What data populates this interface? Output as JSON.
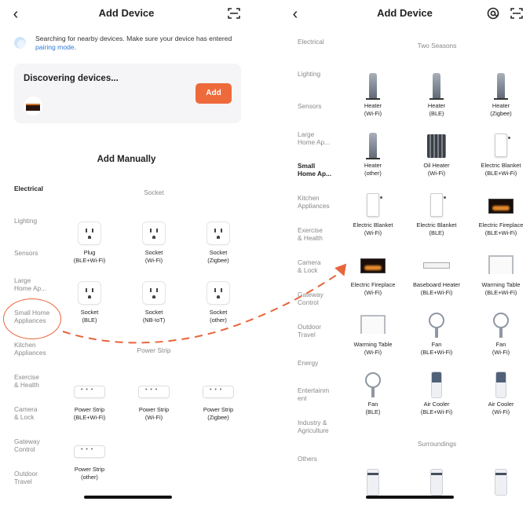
{
  "left": {
    "title": "Add Device",
    "search_text": "Searching for nearby devices. Make sure your device has entered",
    "pairing_link": "pairing mode",
    "search_end": ".",
    "discover_title": "Discovering devices...",
    "add_label": "Add",
    "add_manually": "Add Manually",
    "categories": [
      "Electrical",
      "Lighting",
      "Sensors",
      "Large\nHome Ap...",
      "Small Home\nAppliances",
      "Kitchen\nAppliances",
      "Exercise\n& Health",
      "Camera\n& Lock",
      "Gateway\nControl",
      "Outdoor\nTravel"
    ],
    "active_category": "Electrical",
    "groups": {
      "socket": "Socket",
      "power_strip": "Power Strip"
    },
    "sockets": [
      {
        "name": "Plug",
        "sub": "(BLE+Wi-Fi)"
      },
      {
        "name": "Socket",
        "sub": "(Wi-Fi)"
      },
      {
        "name": "Socket",
        "sub": "(Zigbee)"
      },
      {
        "name": "Socket",
        "sub": "(BLE)"
      },
      {
        "name": "Socket",
        "sub": "(NB-IoT)"
      },
      {
        "name": "Socket",
        "sub": "(other)"
      }
    ],
    "strips": [
      {
        "name": "Power Strip",
        "sub": "(BLE+Wi-Fi)"
      },
      {
        "name": "Power Strip",
        "sub": "(Wi-Fi)"
      },
      {
        "name": "Power Strip",
        "sub": "(Zigbee)"
      },
      {
        "name": "Power Strip",
        "sub": "(other)"
      }
    ]
  },
  "right": {
    "title": "Add Device",
    "categories": [
      "Electrical",
      "Lighting",
      "Sensors",
      "Large\nHome Ap...",
      "Small\nHome Ap...",
      "Kitchen\nAppliances",
      "Exercise\n& Health",
      "Camera\n& Lock",
      "Gateway\nControl",
      "Outdoor\nTravel",
      "Energy",
      "Entertainm\nent",
      "Industry &\nAgriculture",
      "Others"
    ],
    "active_category": "Small\nHome Ap...",
    "groups": {
      "two_seasons": "Two Seasons",
      "surroundings": "Surroundings"
    },
    "devices": [
      {
        "name": "Heater",
        "sub": "(Wi-Fi)",
        "icon": "heater-icon"
      },
      {
        "name": "Heater",
        "sub": "(BLE)",
        "icon": "heater-icon"
      },
      {
        "name": "Heater",
        "sub": "(Zigbee)",
        "icon": "heater-icon"
      },
      {
        "name": "Heater",
        "sub": "(other)",
        "icon": "heater-icon"
      },
      {
        "name": "Oil Heater",
        "sub": "(Wi-Fi)",
        "icon": "oil-heater-icon"
      },
      {
        "name": "Electric Blanket",
        "sub": "(BLE+Wi-Fi)",
        "icon": "electric-blanket-icon"
      },
      {
        "name": "Electric Blanket",
        "sub": "(Wi-Fi)",
        "icon": "electric-blanket-icon"
      },
      {
        "name": "Electric Blanket",
        "sub": "(BLE)",
        "icon": "electric-blanket-icon"
      },
      {
        "name": "Electric Fireplace",
        "sub": "(BLE+Wi-Fi)",
        "icon": "fireplace-icon"
      },
      {
        "name": "Electric Fireplace",
        "sub": "(Wi-Fi)",
        "icon": "fireplace-icon"
      },
      {
        "name": "Baseboard Heater",
        "sub": "(BLE+Wi-Fi)",
        "icon": "baseboard-heater-icon"
      },
      {
        "name": "Warming Table",
        "sub": "(BLE+Wi-Fi)",
        "icon": "warming-table-icon"
      },
      {
        "name": "Warming Table",
        "sub": "(Wi-Fi)",
        "icon": "warming-table-icon"
      },
      {
        "name": "Fan",
        "sub": "(BLE+Wi-Fi)",
        "icon": "fan-icon"
      },
      {
        "name": "Fan",
        "sub": "(Wi-Fi)",
        "icon": "fan-icon"
      },
      {
        "name": "Fan",
        "sub": "(BLE)",
        "icon": "fan-icon"
      },
      {
        "name": "Air Cooler",
        "sub": "(BLE+Wi-Fi)",
        "icon": "air-cooler-icon"
      },
      {
        "name": "Air Cooler",
        "sub": "(Wi-Fi)",
        "icon": "air-cooler-icon"
      }
    ]
  },
  "colors": {
    "accent": "#ee6a3b",
    "link": "#2e79d6",
    "card_bg": "#f5f5f7",
    "muted_text": "#888888"
  }
}
